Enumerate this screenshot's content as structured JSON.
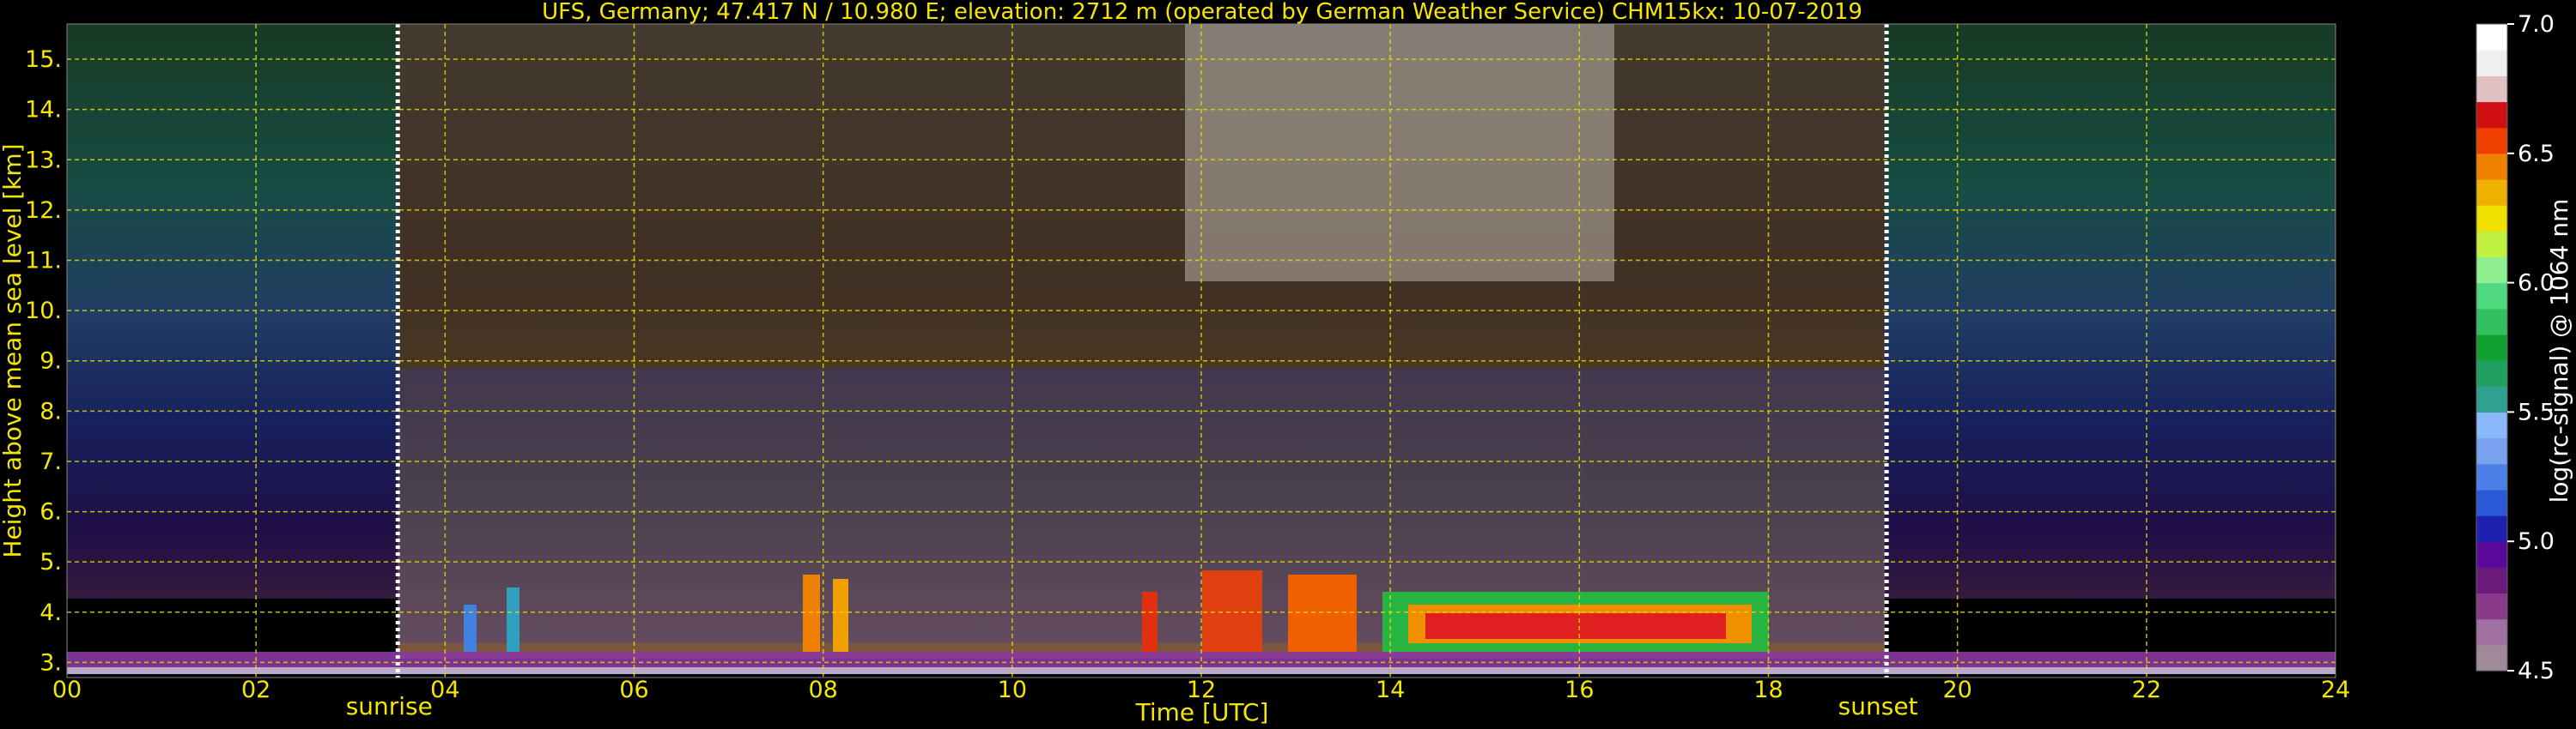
{
  "chart_data": {
    "type": "heatmap",
    "title": "UFS, Germany; 47.417 N / 10.980 E; elevation: 2712 m  (operated by German Weather Service)    CHM15kx: 10-07-2019",
    "xlabel": "Time [UTC]",
    "ylabel": "Height above mean sea level [km]",
    "colorbar_label": "log(rc-signal) @ 1064 nm",
    "xlim": [
      0,
      24
    ],
    "ylim": [
      2.7,
      15.7
    ],
    "clim": [
      4.5,
      7.0
    ],
    "grid": true,
    "x_ticks": [
      {
        "v": 0,
        "label": "00"
      },
      {
        "v": 2,
        "label": "02"
      },
      {
        "v": 4,
        "label": "04"
      },
      {
        "v": 6,
        "label": "06"
      },
      {
        "v": 8,
        "label": "08"
      },
      {
        "v": 10,
        "label": "10"
      },
      {
        "v": 12,
        "label": "12"
      },
      {
        "v": 14,
        "label": "14"
      },
      {
        "v": 16,
        "label": "16"
      },
      {
        "v": 18,
        "label": "18"
      },
      {
        "v": 20,
        "label": "20"
      },
      {
        "v": 22,
        "label": "22"
      },
      {
        "v": 24,
        "label": "24"
      }
    ],
    "y_ticks": [
      {
        "v": 3,
        "label": "3."
      },
      {
        "v": 4,
        "label": "4."
      },
      {
        "v": 5,
        "label": "5."
      },
      {
        "v": 6,
        "label": "6."
      },
      {
        "v": 7,
        "label": "7."
      },
      {
        "v": 8,
        "label": "8."
      },
      {
        "v": 9,
        "label": "9."
      },
      {
        "v": 10,
        "label": "10."
      },
      {
        "v": 11,
        "label": "11."
      },
      {
        "v": 12,
        "label": "12."
      },
      {
        "v": 13,
        "label": "13."
      },
      {
        "v": 14,
        "label": "14."
      },
      {
        "v": 15,
        "label": "15."
      }
    ],
    "colorbar_ticks": [
      {
        "v": 4.5,
        "label": "4.5"
      },
      {
        "v": 5.0,
        "label": "5.0"
      },
      {
        "v": 5.5,
        "label": "5.5"
      },
      {
        "v": 6.0,
        "label": "6.0"
      },
      {
        "v": 6.5,
        "label": "6.5"
      },
      {
        "v": 7.0,
        "label": "7.0"
      }
    ],
    "events": [
      {
        "label": "sunrise",
        "x": 3.5
      },
      {
        "label": "sunset",
        "x": 19.25
      }
    ],
    "colormap": [
      "#a08a9a",
      "#a070a0",
      "#8a3a8a",
      "#6a1a7a",
      "#5a0a9a",
      "#2020b0",
      "#2a5ad8",
      "#4a80e8",
      "#7aa0f0",
      "#8ab8f8",
      "#30a090",
      "#20a060",
      "#10a030",
      "#30c060",
      "#50d880",
      "#90f090",
      "#c0f040",
      "#f0e000",
      "#f0b000",
      "#f08000",
      "#f04000",
      "#d01010",
      "#e0c0c0",
      "#f0f0f0",
      "#ffffff"
    ],
    "colors": {
      "text": "#f5e600",
      "grid": "#e6dc00",
      "marker": "#ffffff",
      "background": "#000000"
    }
  }
}
